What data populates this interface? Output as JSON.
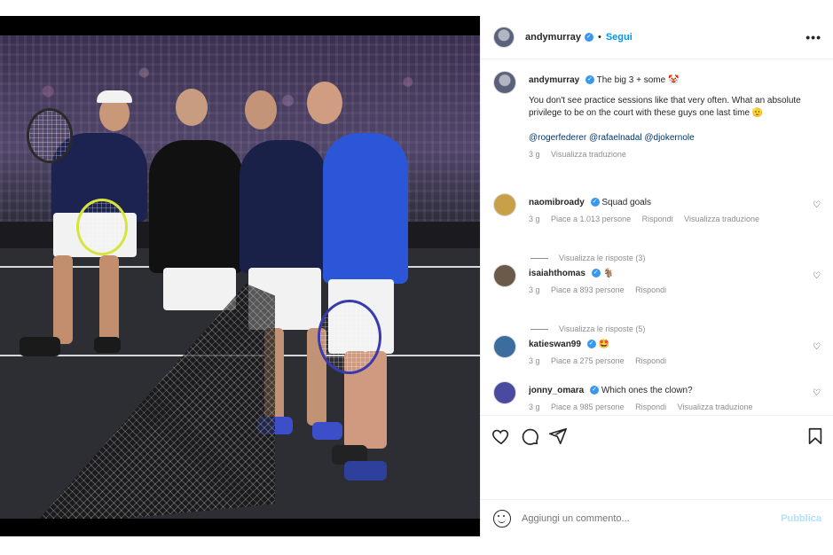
{
  "header": {
    "username": "andymurray",
    "separator": "•",
    "follow_label": "Segui",
    "more_label": "•••"
  },
  "caption": {
    "username": "andymurray",
    "text": "The big 3 + some 🤡",
    "body": "You don't see practice sessions like that very often. What an absolute privilege to be on the court with these guys one last time 🫡",
    "mentions": "@rogerfederer @rafaelnadal @djokernole",
    "time": "3 g",
    "translate": "Visualizza traduzione"
  },
  "comments": [
    {
      "username": "naomibroady",
      "text": "Squad goals",
      "time": "3 g",
      "likes": "Piace a 1.013 persone",
      "reply": "Rispondi",
      "translate": "Visualizza traduzione",
      "replies": "Visualizza le risposte (3)",
      "avatar_color": "#c9a04a"
    },
    {
      "username": "isaiahthomas",
      "text": "🐐",
      "time": "3 g",
      "likes": "Piace a 893 persone",
      "reply": "Rispondi",
      "translate": "",
      "replies": "Visualizza le risposte (5)",
      "avatar_color": "#6b5a4a"
    },
    {
      "username": "katieswan99",
      "text": "🤩",
      "time": "3 g",
      "likes": "Piace a 275 persone",
      "reply": "Rispondi",
      "translate": "",
      "replies": "",
      "avatar_color": "#3b6e9e"
    },
    {
      "username": "jonny_omara",
      "text": "Which ones the clown?",
      "time": "3 g",
      "likes": "Piace a 985 persone",
      "reply": "Rispondi",
      "translate": "Visualizza traduzione",
      "replies": "",
      "avatar_color": "#4a4aa0"
    }
  ],
  "add_comment": {
    "placeholder": "Aggiungi un commento...",
    "publish_label": "Pubblica"
  },
  "icons": {
    "heart": "heart-icon",
    "comment": "comment-icon",
    "share": "share-icon",
    "save": "bookmark-icon",
    "emoji": "emoji-icon",
    "more": "more-icon"
  },
  "colors": {
    "accent": "#0095f6",
    "verified": "#3897f0",
    "muted": "#8e8e8e",
    "link": "#00376b",
    "publish_disabled": "#b2dffc"
  }
}
